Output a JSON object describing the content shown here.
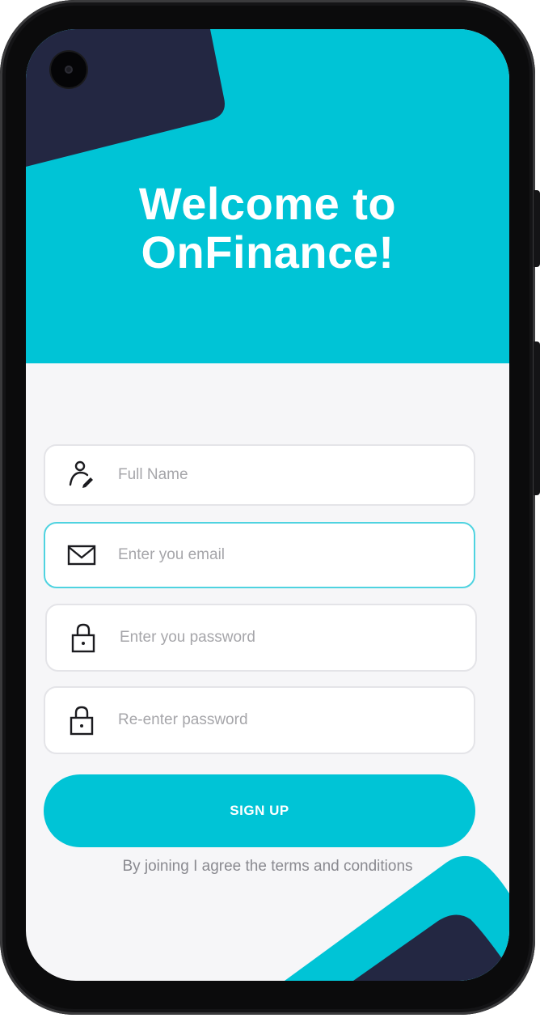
{
  "header": {
    "title_line1": "Welcome to",
    "title_line2": "OnFinance!"
  },
  "form": {
    "full_name_placeholder": "Full Name",
    "email_placeholder": "Enter you email",
    "password_placeholder": "Enter you password",
    "reenter_password_placeholder": "Re-enter password"
  },
  "signup_label": "SIGN UP",
  "terms_text": "By joining I agree the terms and conditions",
  "colors": {
    "accent": "#00c4d6",
    "dark_shape": "#232742",
    "background": "#f6f6f8"
  },
  "icons": {
    "full_name": "user-edit-icon",
    "email": "mail-icon",
    "password": "lock-icon",
    "reenter_password": "lock-icon"
  }
}
